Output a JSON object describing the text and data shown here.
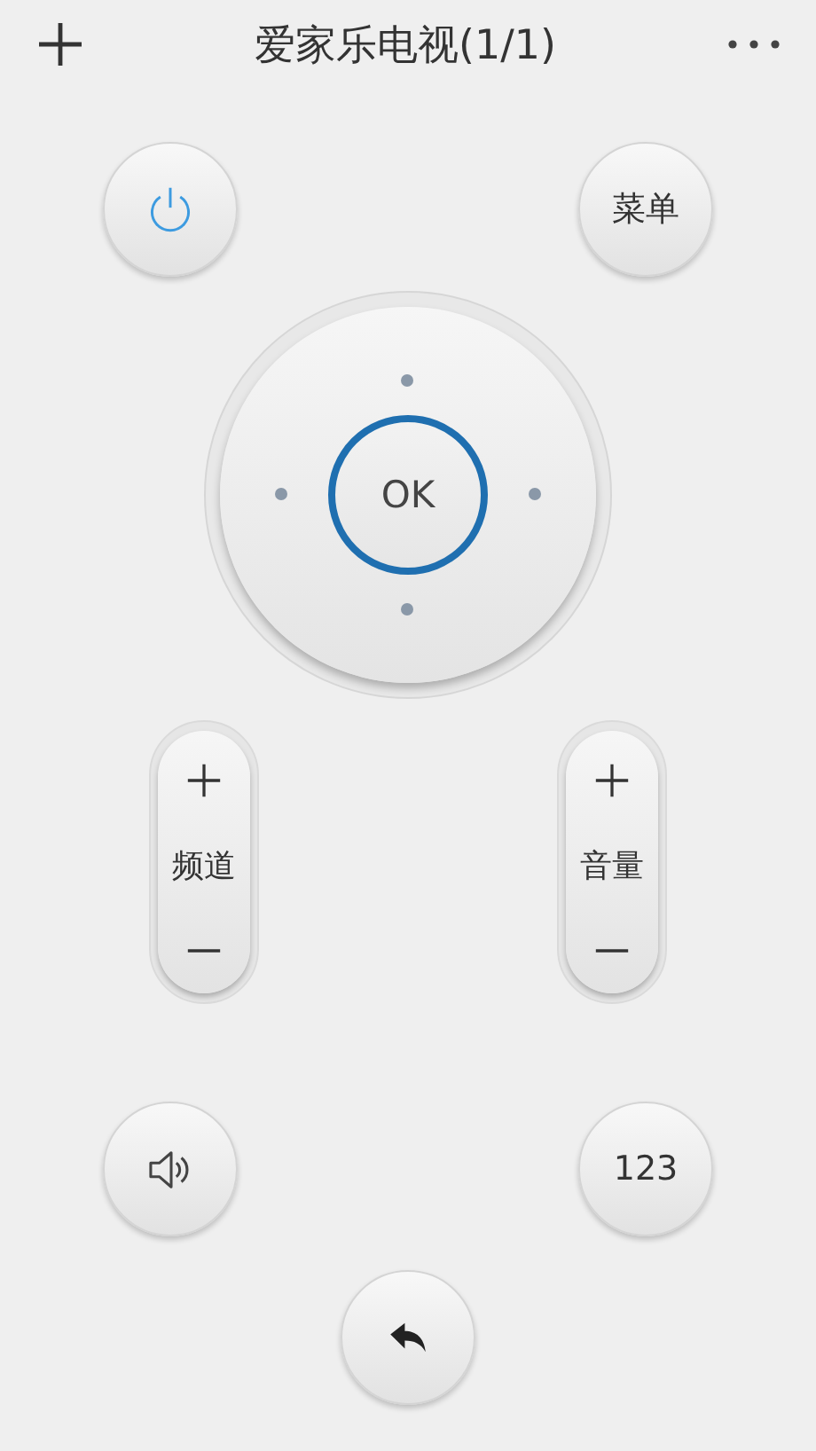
{
  "header": {
    "title": "爱家乐电视(1/1)"
  },
  "menu_button": {
    "label": "菜单"
  },
  "dpad": {
    "center_label": "OK"
  },
  "rockers": [
    {
      "label": "频道"
    },
    {
      "label": "音量"
    }
  ],
  "number_button": {
    "label": "123"
  }
}
